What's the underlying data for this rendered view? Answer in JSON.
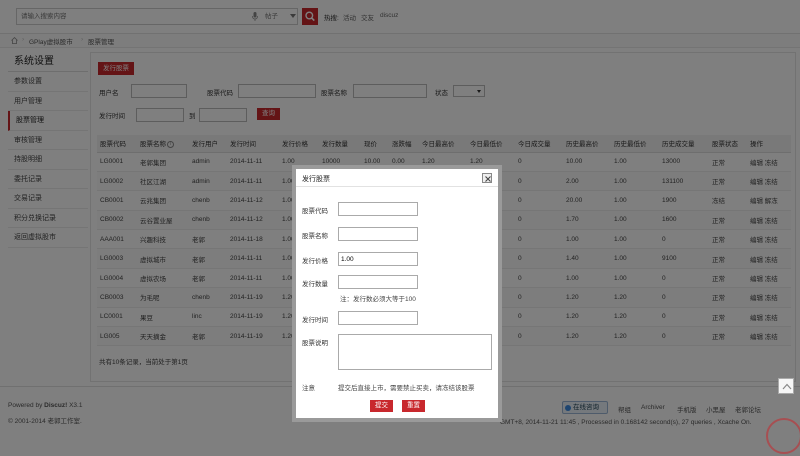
{
  "topbar": {
    "search_placeholder": "请输入搜索内容",
    "scope": "帖子",
    "hot_label": "热搜:",
    "hot_links": [
      "活动",
      "交友",
      "discuz"
    ]
  },
  "breadcrumb": [
    "GPlay虚拟股市",
    "股票管理"
  ],
  "sidebar": {
    "title": "系统设置",
    "items": [
      "参数设置",
      "用户管理",
      "股票管理",
      "审核管理",
      "持股明细",
      "委托记录",
      "交易记录",
      "积分兑换记录",
      "返回虚拟股市"
    ],
    "active_index": 2
  },
  "main": {
    "issue_button": "发行股票",
    "filters": {
      "username_label": "用户名",
      "code_label": "股票代码",
      "name_label": "股票名称",
      "status_label": "状态",
      "time_label": "发行时间",
      "to_label": "到",
      "query_button": "查询"
    },
    "table": {
      "headers": [
        "股票代码",
        "股票名称",
        "发行用户",
        "发行时间",
        "发行价格",
        "发行数量",
        "现价",
        "涨跌幅",
        "今日最高价",
        "今日最低价",
        "今日成交量",
        "历史最高价",
        "历史最低价",
        "历史成交量",
        "股票状态",
        "操作"
      ],
      "rows": [
        [
          "LG0001",
          "老郭集团",
          "admin",
          "2014-11-11",
          "1.00",
          "10000",
          "10.00",
          "0.00",
          "1.20",
          "1.20",
          "0",
          "10.00",
          "1.00",
          "13000",
          "正常",
          "编辑 冻结"
        ],
        [
          "LG0002",
          "社区江湖",
          "admin",
          "2014-11-11",
          "1.00",
          "",
          "",
          "",
          "",
          "",
          "0",
          "2.00",
          "1.00",
          "131100",
          "正常",
          "编辑 冻结"
        ],
        [
          "CB0001",
          "云兆集团",
          "chenb",
          "2014-11-12",
          "1.00",
          "",
          "",
          "",
          "",
          "",
          "0",
          "20.00",
          "1.00",
          "1900",
          "冻结",
          "编辑 解冻"
        ],
        [
          "CB0002",
          "云谷置业屋",
          "chenb",
          "2014-11-12",
          "1.00",
          "",
          "",
          "",
          "",
          "",
          "0",
          "1.70",
          "1.00",
          "1600",
          "正常",
          "编辑 冻结"
        ],
        [
          "AAA001",
          "兴趣科技",
          "老郭",
          "2014-11-18",
          "1.00",
          "",
          "",
          "",
          "",
          "",
          "0",
          "1.00",
          "1.00",
          "0",
          "正常",
          "编辑 冻结"
        ],
        [
          "LG0003",
          "虚拟城市",
          "老郭",
          "2014-11-11",
          "1.00",
          "",
          "",
          "",
          "",
          "",
          "0",
          "1.40",
          "1.00",
          "9100",
          "正常",
          "编辑 冻结"
        ],
        [
          "LG0004",
          "虚拟农场",
          "老郭",
          "2014-11-11",
          "1.00",
          "",
          "",
          "",
          "",
          "",
          "0",
          "1.00",
          "1.00",
          "0",
          "正常",
          "编辑 冻结"
        ],
        [
          "CB0003",
          "为毛呢",
          "chenb",
          "2014-11-19",
          "1.20",
          "",
          "",
          "",
          "",
          "",
          "0",
          "1.20",
          "1.20",
          "0",
          "正常",
          "编辑 冻结"
        ],
        [
          "LC0001",
          "果豆",
          "linc",
          "2014-11-19",
          "1.20",
          "",
          "",
          "",
          "",
          "",
          "0",
          "1.20",
          "1.20",
          "0",
          "正常",
          "编辑 冻结"
        ],
        [
          "LG005",
          "天天摘金",
          "老郭",
          "2014-11-19",
          "1.20",
          "",
          "",
          "",
          "",
          "",
          "0",
          "1.20",
          "1.20",
          "0",
          "正常",
          "编辑 冻结"
        ]
      ]
    },
    "summary": "共有10条记录，当前处于第1页"
  },
  "footer": {
    "powered_prefix": "Powered by ",
    "powered_brand": "Discuz!",
    "powered_version": " X3.1",
    "copyright": "© 2001-2014 老郭工作室.",
    "qq_button": "在线咨询",
    "links": [
      "帮组",
      "Archiver",
      "手机版",
      "小黑屋",
      "老郭论坛"
    ],
    "process_info": "GMT+8, 2014-11-21 11:45 , Processed in 0.168142 second(s), 27 queries , Xcache On."
  },
  "modal": {
    "title": "发行股票",
    "code_label": "股票代码",
    "name_label": "股票名称",
    "price_label": "发行价格",
    "price_value": "1.00",
    "amount_label": "发行数量",
    "amount_note": "注：发行数必须大等于100",
    "time_label": "发行时间",
    "desc_label": "股票说明",
    "notice_label": "注意",
    "notice_text": "提交后直接上市，需要禁止买卖，请冻结该股票",
    "submit_button": "提交",
    "reset_button": "重置"
  },
  "colors": {
    "accent": "#c8282d",
    "overlay": "#000000"
  }
}
